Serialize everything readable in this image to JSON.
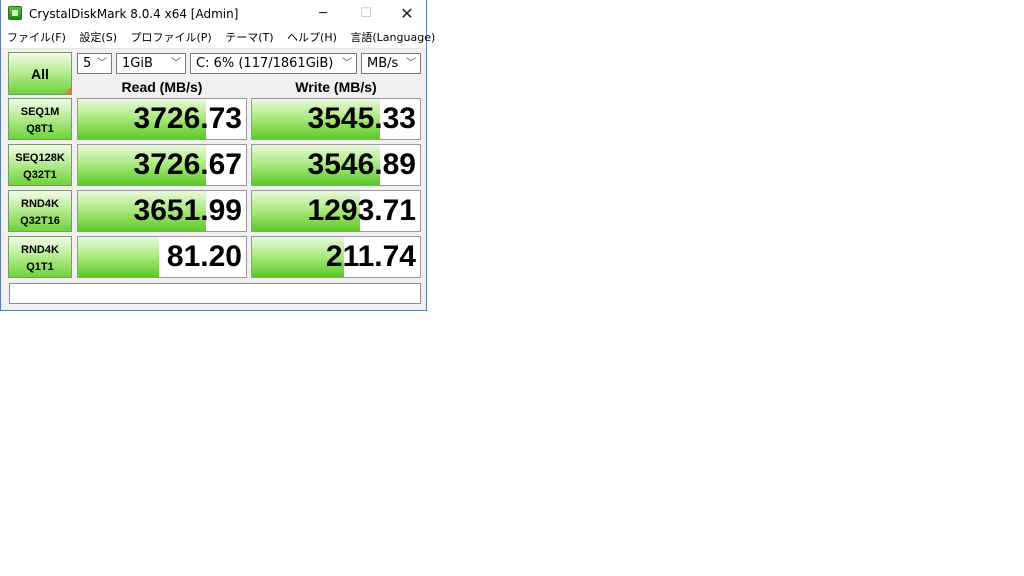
{
  "window": {
    "title": "CrystalDiskMark 8.0.4 x64 [Admin]",
    "min_glyph": "─",
    "max_glyph": "☐",
    "close_glyph": "✕"
  },
  "menu": [
    "ファイル(F)",
    "設定(S)",
    "プロファイル(P)",
    "テーマ(T)",
    "ヘルプ(H)",
    "言語(Language)"
  ],
  "controls": {
    "all_label": "All",
    "count": "5",
    "size": "1GiB",
    "drive": "C: 6% (117/1861GiB)",
    "unit": "MB/s"
  },
  "headers": {
    "read": "Read (MB/s)",
    "write": "Write (MB/s)"
  },
  "rows": [
    {
      "label1": "SEQ1M",
      "label2": "Q8T1",
      "read": "3726.73",
      "write": "3545.33",
      "read_fill": 0.76,
      "write_fill": 0.76
    },
    {
      "label1": "SEQ128K",
      "label2": "Q32T1",
      "read": "3726.67",
      "write": "3546.89",
      "read_fill": 0.76,
      "write_fill": 0.76
    },
    {
      "label1": "RND4K",
      "label2": "Q32T16",
      "read": "3651.99",
      "write": "1293.71",
      "read_fill": 0.76,
      "write_fill": 0.64
    },
    {
      "label1": "RND4K",
      "label2": "Q1T1",
      "read": "81.20",
      "write": "211.74",
      "read_fill": 0.48,
      "write_fill": 0.55
    }
  ],
  "comment": "",
  "colors": {
    "bar_green": "#5cc828",
    "label_green": "#6fd23b",
    "corner_orange": "#e8822a"
  }
}
